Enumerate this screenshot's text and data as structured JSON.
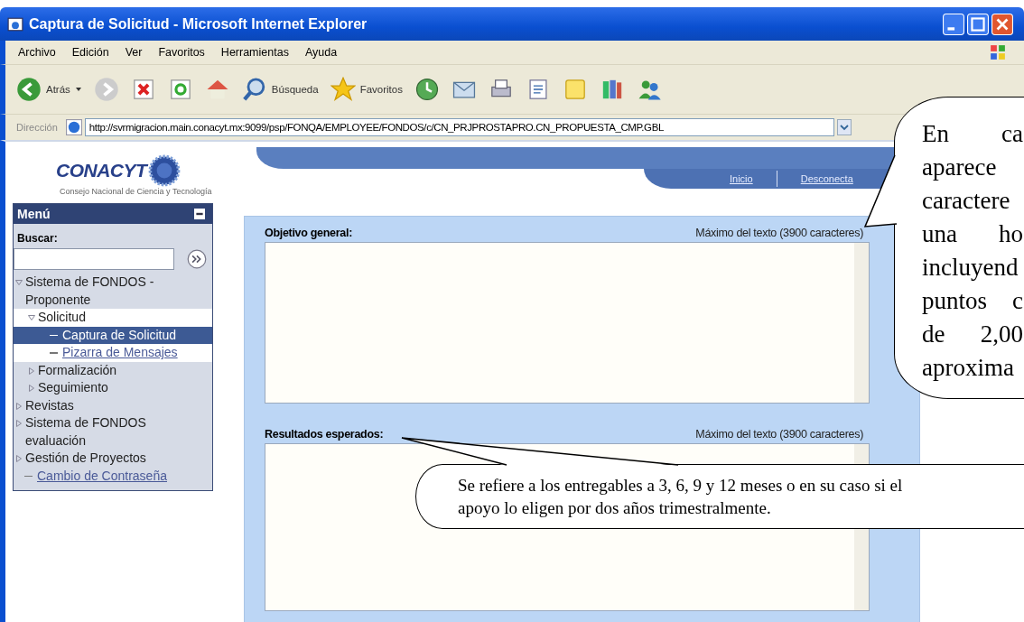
{
  "window": {
    "title": "Captura de Solicitud - Microsoft Internet Explorer"
  },
  "menu_bar": [
    "Archivo",
    "Edición",
    "Ver",
    "Favoritos",
    "Herramientas",
    "Ayuda"
  ],
  "toolbar": {
    "back": "Atrás",
    "search": "Búsqueda",
    "favorites": "Favoritos"
  },
  "address_bar": {
    "label": "Dirección",
    "value": "http://svrmigracion.main.conacyt.mx:9099/psp/FONQA/EMPLOYEE/FONDOS/c/CN_PRJPROSTAPRO.CN_PROPUESTA_CMP.GBL"
  },
  "logo": {
    "name": "CONACYT",
    "subtitle": "Consejo Nacional de Ciencia y Tecnología"
  },
  "top_nav": [
    "Inicio",
    "Desconecta"
  ],
  "sidebar": {
    "title": "Menú",
    "search_label": "Buscar:",
    "items": [
      {
        "label": "Sistema de FONDOS - Proponente",
        "kind": "folder",
        "expanded": true,
        "children": [
          {
            "label": "Solicitud",
            "kind": "folder",
            "expanded": true,
            "children": [
              {
                "label": "Captura de Solicitud",
                "kind": "link",
                "selected": true
              },
              {
                "label": "Pizarra de Mensajes",
                "kind": "link",
                "selected": false
              }
            ]
          },
          {
            "label": "Formalización",
            "kind": "folder",
            "expanded": false
          },
          {
            "label": "Seguimiento",
            "kind": "folder",
            "expanded": false
          }
        ]
      },
      {
        "label": "Revistas",
        "kind": "folder",
        "expanded": false
      },
      {
        "label": "Sistema de FONDOS evaluación",
        "kind": "folder",
        "expanded": false
      },
      {
        "label": "Gestión de Proyectos",
        "kind": "folder",
        "expanded": false
      },
      {
        "label": "Cambio de Contraseña",
        "kind": "link",
        "selected": false
      }
    ]
  },
  "form": {
    "fields": [
      {
        "label": "Objetivo general:",
        "limit": "Máximo del texto (3900 caracteres)"
      },
      {
        "label": "Resultados esperados:",
        "limit": "Máximo del texto (3900 caracteres)"
      }
    ]
  },
  "callouts": [
    {
      "lines": [
        "En ca",
        "aparece",
        "caractere",
        "una ho",
        "incluyend",
        "puntos c",
        "de 2,00",
        "aproxima"
      ]
    },
    {
      "lines": [
        "Se refiere a los entregables a 3, 6, 9 y 12 meses o en su caso si el",
        "apoyo lo eligen por dos años trimestralmente."
      ]
    }
  ]
}
